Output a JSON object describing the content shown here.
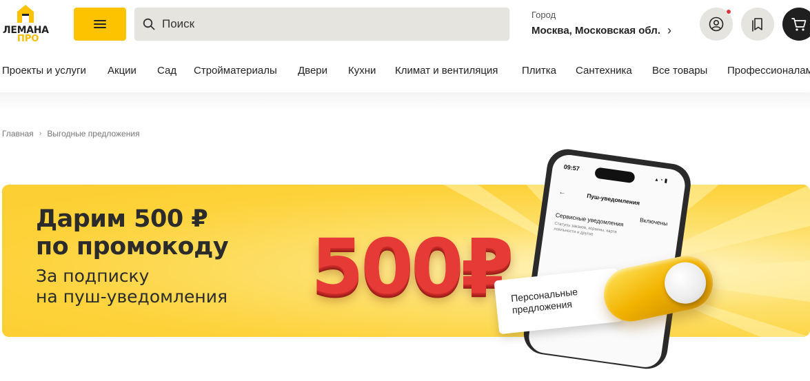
{
  "header": {
    "logo_line1": "ЛЕМАНА",
    "logo_line2": "ПРО",
    "search_placeholder": "Поиск",
    "city_label": "Город",
    "city_value": "Москва, Московская обл."
  },
  "nav": {
    "items": [
      "Проекты и услуги",
      "Акции",
      "Сад",
      "Стройматериалы",
      "Двери",
      "Кухни",
      "Климат и вентиляция",
      "Плитка",
      "Сантехника",
      "Все товары",
      "Профессионалам"
    ]
  },
  "breadcrumb": {
    "home": "Главная",
    "current": "Выгодные предложения"
  },
  "banner": {
    "title_line1": "Дарим 500 ₽",
    "title_line2": "по промокоду",
    "sub_line1": "За подписку",
    "sub_line2": "на пуш-уведомления",
    "amount": "500₽",
    "phone_time": "09:57",
    "phone_title": "Пуш-уведомления",
    "phone_row_label": "Сервисные уведомления",
    "phone_row_state": "Включены",
    "phone_row_desc": "Статусы заказов, корзины, карта лояльности и другое",
    "card_text": "Персональные предложения"
  },
  "colors": {
    "accent": "#fdc300",
    "banner_bg": "#fdd23a",
    "amount_red": "#e63a36",
    "notification_dot": "#e4333b"
  }
}
